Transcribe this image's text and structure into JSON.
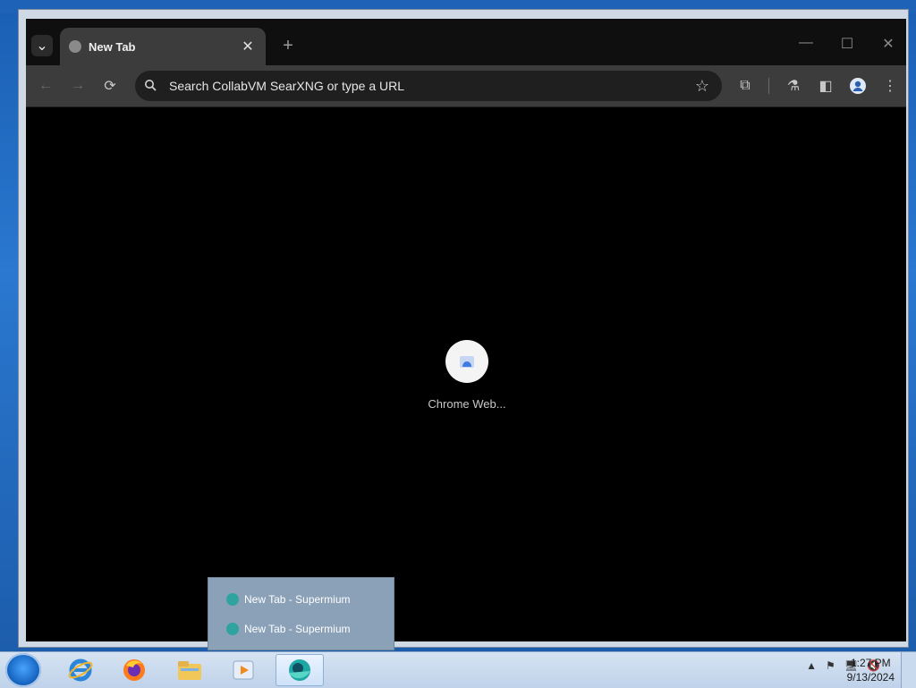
{
  "browser": {
    "tab": {
      "title": "New Tab",
      "close_glyph": "✕"
    },
    "new_tab_glyph": "+",
    "tab_list_glyph": "⌄",
    "window_controls": {
      "minimize": "—",
      "maximize": "☐",
      "close": "✕"
    },
    "toolbar": {
      "back_glyph": "←",
      "forward_glyph": "→",
      "reload_glyph": "⟳",
      "omnibox_placeholder": "Search CollabVM SearXNG or type a URL",
      "star_glyph": "☆",
      "extensions_glyph": "⧉",
      "labs_glyph": "⚗",
      "sidepanel_glyph": "◧",
      "menu_glyph": "⋮"
    },
    "shortcut": {
      "label": "Chrome Web..."
    }
  },
  "taskbar": {
    "apps": [
      {
        "name": "internet-explorer-icon"
      },
      {
        "name": "firefox-icon"
      },
      {
        "name": "file-explorer-icon"
      },
      {
        "name": "media-player-icon"
      },
      {
        "name": "supermium-icon"
      }
    ],
    "popup_items": [
      "New Tab - Supermium",
      "New Tab - Supermium"
    ],
    "clock": {
      "time": "1:27 PM",
      "date": "9/13/2024"
    }
  }
}
